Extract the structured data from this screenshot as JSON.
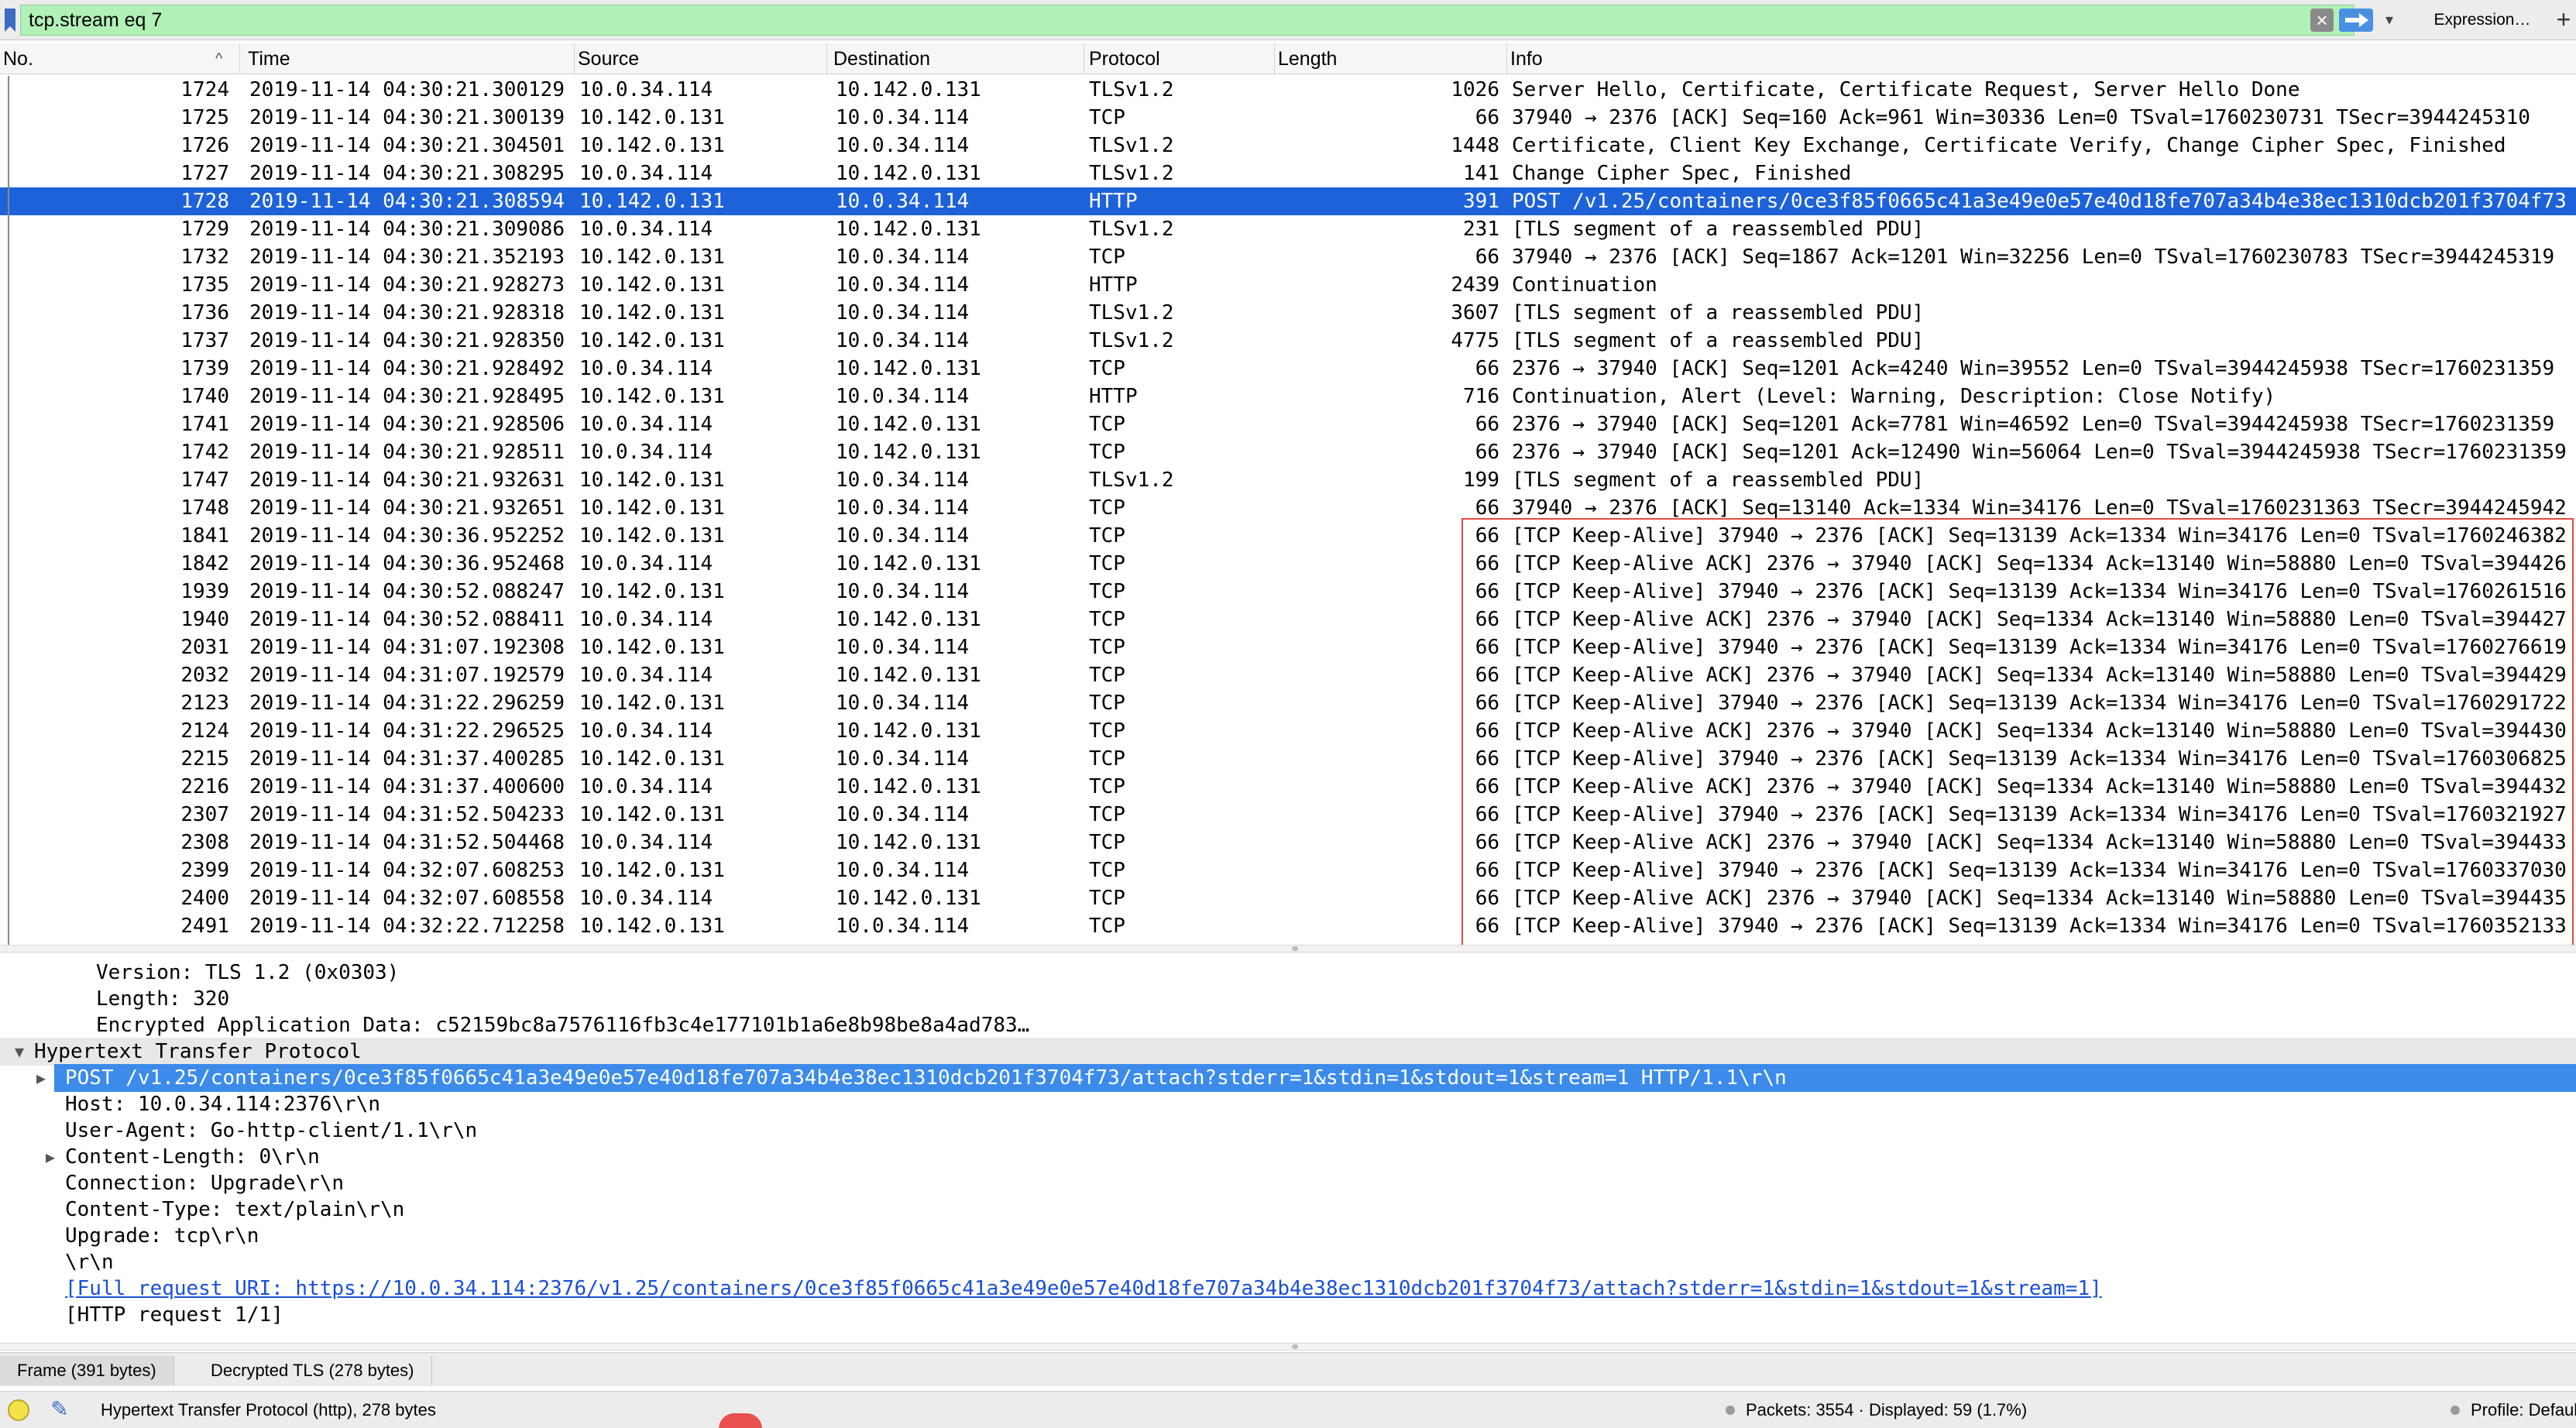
{
  "filter": {
    "expression": "tcp.stream eq 7",
    "expression_button": "Expression…",
    "add_button": "+"
  },
  "columns": [
    "No.",
    "Time",
    "Source",
    "Destination",
    "Protocol",
    "Length",
    "Info"
  ],
  "packets": [
    {
      "no": "1724",
      "time": "2019-11-14 04:30:21.300129",
      "src": "10.0.34.114",
      "dst": "10.142.0.131",
      "proto": "TLSv1.2",
      "len": "1026",
      "info": "Server Hello, Certificate, Certificate Request, Server Hello Done"
    },
    {
      "no": "1725",
      "time": "2019-11-14 04:30:21.300139",
      "src": "10.142.0.131",
      "dst": "10.0.34.114",
      "proto": "TCP",
      "len": "66",
      "info": "37940 → 2376 [ACK] Seq=160 Ack=961 Win=30336 Len=0 TSval=1760230731 TSecr=3944245310"
    },
    {
      "no": "1726",
      "time": "2019-11-14 04:30:21.304501",
      "src": "10.142.0.131",
      "dst": "10.0.34.114",
      "proto": "TLSv1.2",
      "len": "1448",
      "info": "Certificate, Client Key Exchange, Certificate Verify, Change Cipher Spec, Finished"
    },
    {
      "no": "1727",
      "time": "2019-11-14 04:30:21.308295",
      "src": "10.0.34.114",
      "dst": "10.142.0.131",
      "proto": "TLSv1.2",
      "len": "141",
      "info": "Change Cipher Spec, Finished"
    },
    {
      "no": "1728",
      "time": "2019-11-14 04:30:21.308594",
      "src": "10.142.0.131",
      "dst": "10.0.34.114",
      "proto": "HTTP",
      "len": "391",
      "info": "POST /v1.25/containers/0ce3f85f0665c41a3e49e0e57e40d18fe707a34b4e38ec1310dcb201f3704f73",
      "selected": true
    },
    {
      "no": "1729",
      "time": "2019-11-14 04:30:21.309086",
      "src": "10.0.34.114",
      "dst": "10.142.0.131",
      "proto": "TLSv1.2",
      "len": "231",
      "info": "[TLS segment of a reassembled PDU]"
    },
    {
      "no": "1732",
      "time": "2019-11-14 04:30:21.352193",
      "src": "10.142.0.131",
      "dst": "10.0.34.114",
      "proto": "TCP",
      "len": "66",
      "info": "37940 → 2376 [ACK] Seq=1867 Ack=1201 Win=32256 Len=0 TSval=1760230783 TSecr=3944245319"
    },
    {
      "no": "1735",
      "time": "2019-11-14 04:30:21.928273",
      "src": "10.142.0.131",
      "dst": "10.0.34.114",
      "proto": "HTTP",
      "len": "2439",
      "info": "Continuation"
    },
    {
      "no": "1736",
      "time": "2019-11-14 04:30:21.928318",
      "src": "10.142.0.131",
      "dst": "10.0.34.114",
      "proto": "TLSv1.2",
      "len": "3607",
      "info": "[TLS segment of a reassembled PDU]"
    },
    {
      "no": "1737",
      "time": "2019-11-14 04:30:21.928350",
      "src": "10.142.0.131",
      "dst": "10.0.34.114",
      "proto": "TLSv1.2",
      "len": "4775",
      "info": "[TLS segment of a reassembled PDU]"
    },
    {
      "no": "1739",
      "time": "2019-11-14 04:30:21.928492",
      "src": "10.0.34.114",
      "dst": "10.142.0.131",
      "proto": "TCP",
      "len": "66",
      "info": "2376 → 37940 [ACK] Seq=1201 Ack=4240 Win=39552 Len=0 TSval=3944245938 TSecr=1760231359"
    },
    {
      "no": "1740",
      "time": "2019-11-14 04:30:21.928495",
      "src": "10.142.0.131",
      "dst": "10.0.34.114",
      "proto": "HTTP",
      "len": "716",
      "info": "Continuation, Alert (Level: Warning, Description: Close Notify)"
    },
    {
      "no": "1741",
      "time": "2019-11-14 04:30:21.928506",
      "src": "10.0.34.114",
      "dst": "10.142.0.131",
      "proto": "TCP",
      "len": "66",
      "info": "2376 → 37940 [ACK] Seq=1201 Ack=7781 Win=46592 Len=0 TSval=3944245938 TSecr=1760231359"
    },
    {
      "no": "1742",
      "time": "2019-11-14 04:30:21.928511",
      "src": "10.0.34.114",
      "dst": "10.142.0.131",
      "proto": "TCP",
      "len": "66",
      "info": "2376 → 37940 [ACK] Seq=1201 Ack=12490 Win=56064 Len=0 TSval=3944245938 TSecr=1760231359"
    },
    {
      "no": "1747",
      "time": "2019-11-14 04:30:21.932631",
      "src": "10.142.0.131",
      "dst": "10.0.34.114",
      "proto": "TLSv1.2",
      "len": "199",
      "info": "[TLS segment of a reassembled PDU]"
    },
    {
      "no": "1748",
      "time": "2019-11-14 04:30:21.932651",
      "src": "10.142.0.131",
      "dst": "10.0.34.114",
      "proto": "TCP",
      "len": "66",
      "info": "37940 → 2376 [ACK] Seq=13140 Ack=1334 Win=34176 Len=0 TSval=1760231363 TSecr=3944245942"
    },
    {
      "no": "1841",
      "time": "2019-11-14 04:30:36.952252",
      "src": "10.142.0.131",
      "dst": "10.0.34.114",
      "proto": "TCP",
      "len": "66",
      "info": "[TCP Keep-Alive] 37940 → 2376 [ACK] Seq=13139 Ack=1334 Win=34176 Len=0 TSval=1760246382"
    },
    {
      "no": "1842",
      "time": "2019-11-14 04:30:36.952468",
      "src": "10.0.34.114",
      "dst": "10.142.0.131",
      "proto": "TCP",
      "len": "66",
      "info": "[TCP Keep-Alive ACK] 2376 → 37940 [ACK] Seq=1334 Ack=13140 Win=58880 Len=0 TSval=394426"
    },
    {
      "no": "1939",
      "time": "2019-11-14 04:30:52.088247",
      "src": "10.142.0.131",
      "dst": "10.0.34.114",
      "proto": "TCP",
      "len": "66",
      "info": "[TCP Keep-Alive] 37940 → 2376 [ACK] Seq=13139 Ack=1334 Win=34176 Len=0 TSval=1760261516"
    },
    {
      "no": "1940",
      "time": "2019-11-14 04:30:52.088411",
      "src": "10.0.34.114",
      "dst": "10.142.0.131",
      "proto": "TCP",
      "len": "66",
      "info": "[TCP Keep-Alive ACK] 2376 → 37940 [ACK] Seq=1334 Ack=13140 Win=58880 Len=0 TSval=394427"
    },
    {
      "no": "2031",
      "time": "2019-11-14 04:31:07.192308",
      "src": "10.142.0.131",
      "dst": "10.0.34.114",
      "proto": "TCP",
      "len": "66",
      "info": "[TCP Keep-Alive] 37940 → 2376 [ACK] Seq=13139 Ack=1334 Win=34176 Len=0 TSval=1760276619"
    },
    {
      "no": "2032",
      "time": "2019-11-14 04:31:07.192579",
      "src": "10.0.34.114",
      "dst": "10.142.0.131",
      "proto": "TCP",
      "len": "66",
      "info": "[TCP Keep-Alive ACK] 2376 → 37940 [ACK] Seq=1334 Ack=13140 Win=58880 Len=0 TSval=394429"
    },
    {
      "no": "2123",
      "time": "2019-11-14 04:31:22.296259",
      "src": "10.142.0.131",
      "dst": "10.0.34.114",
      "proto": "TCP",
      "len": "66",
      "info": "[TCP Keep-Alive] 37940 → 2376 [ACK] Seq=13139 Ack=1334 Win=34176 Len=0 TSval=1760291722"
    },
    {
      "no": "2124",
      "time": "2019-11-14 04:31:22.296525",
      "src": "10.0.34.114",
      "dst": "10.142.0.131",
      "proto": "TCP",
      "len": "66",
      "info": "[TCP Keep-Alive ACK] 2376 → 37940 [ACK] Seq=1334 Ack=13140 Win=58880 Len=0 TSval=394430"
    },
    {
      "no": "2215",
      "time": "2019-11-14 04:31:37.400285",
      "src": "10.142.0.131",
      "dst": "10.0.34.114",
      "proto": "TCP",
      "len": "66",
      "info": "[TCP Keep-Alive] 37940 → 2376 [ACK] Seq=13139 Ack=1334 Win=34176 Len=0 TSval=1760306825"
    },
    {
      "no": "2216",
      "time": "2019-11-14 04:31:37.400600",
      "src": "10.0.34.114",
      "dst": "10.142.0.131",
      "proto": "TCP",
      "len": "66",
      "info": "[TCP Keep-Alive ACK] 2376 → 37940 [ACK] Seq=1334 Ack=13140 Win=58880 Len=0 TSval=394432"
    },
    {
      "no": "2307",
      "time": "2019-11-14 04:31:52.504233",
      "src": "10.142.0.131",
      "dst": "10.0.34.114",
      "proto": "TCP",
      "len": "66",
      "info": "[TCP Keep-Alive] 37940 → 2376 [ACK] Seq=13139 Ack=1334 Win=34176 Len=0 TSval=1760321927"
    },
    {
      "no": "2308",
      "time": "2019-11-14 04:31:52.504468",
      "src": "10.0.34.114",
      "dst": "10.142.0.131",
      "proto": "TCP",
      "len": "66",
      "info": "[TCP Keep-Alive ACK] 2376 → 37940 [ACK] Seq=1334 Ack=13140 Win=58880 Len=0 TSval=394433"
    },
    {
      "no": "2399",
      "time": "2019-11-14 04:32:07.608253",
      "src": "10.142.0.131",
      "dst": "10.0.34.114",
      "proto": "TCP",
      "len": "66",
      "info": "[TCP Keep-Alive] 37940 → 2376 [ACK] Seq=13139 Ack=1334 Win=34176 Len=0 TSval=1760337030"
    },
    {
      "no": "2400",
      "time": "2019-11-14 04:32:07.608558",
      "src": "10.0.34.114",
      "dst": "10.142.0.131",
      "proto": "TCP",
      "len": "66",
      "info": "[TCP Keep-Alive ACK] 2376 → 37940 [ACK] Seq=1334 Ack=13140 Win=58880 Len=0 TSval=394435"
    },
    {
      "no": "2491",
      "time": "2019-11-14 04:32:22.712258",
      "src": "10.142.0.131",
      "dst": "10.0.34.114",
      "proto": "TCP",
      "len": "66",
      "info": "[TCP Keep-Alive] 37940 → 2376 [ACK] Seq=13139 Ack=1334 Win=34176 Len=0 TSval=1760352133"
    }
  ],
  "details": [
    {
      "text": "Version: TLS 1.2 (0x0303)",
      "indent": 2,
      "expander": false
    },
    {
      "text": "Length: 320",
      "indent": 2,
      "expander": false
    },
    {
      "text": "Encrypted Application Data: c52159bc8a7576116fb3c4e177101b1a6e8b98be8a4ad783…",
      "indent": 2,
      "expander": false
    },
    {
      "text": "Hypertext Transfer Protocol",
      "indent": 0,
      "expander": "open",
      "section": true
    },
    {
      "text": "POST /v1.25/containers/0ce3f85f0665c41a3e49e0e57e40d18fe707a34b4e38ec1310dcb201f3704f73/attach?stderr=1&stdin=1&stdout=1&stream=1 HTTP/1.1\\r\\n",
      "indent": 1,
      "expander": "closed",
      "selected": true
    },
    {
      "text": "Host: 10.0.34.114:2376\\r\\n",
      "indent": 1,
      "expander": false
    },
    {
      "text": "User-Agent: Go-http-client/1.1\\r\\n",
      "indent": 1,
      "expander": false
    },
    {
      "text": "Content-Length: 0\\r\\n",
      "indent": 1,
      "expander": "closed"
    },
    {
      "text": "Connection: Upgrade\\r\\n",
      "indent": 1,
      "expander": false
    },
    {
      "text": "Content-Type: text/plain\\r\\n",
      "indent": 1,
      "expander": false
    },
    {
      "text": "Upgrade: tcp\\r\\n",
      "indent": 1,
      "expander": false
    },
    {
      "text": "\\r\\n",
      "indent": 1,
      "expander": false
    },
    {
      "text": "[Full request URI: https://10.0.34.114:2376/v1.25/containers/0ce3f85f0665c41a3e49e0e57e40d18fe707a34b4e38ec1310dcb201f3704f73/attach?stderr=1&stdin=1&stdout=1&stream=1]",
      "indent": 1,
      "expander": false,
      "link": true
    },
    {
      "text": "[HTTP request 1/1]",
      "indent": 1,
      "expander": false
    }
  ],
  "bytes_tabs": [
    "Frame (391 bytes)",
    "Decrypted TLS (278 bytes)"
  ],
  "status": {
    "field": "Hypertext Transfer Protocol (http), 278 bytes",
    "packets": "Packets: 3554 · Displayed: 59 (1.7%)",
    "profile": "Profile: Default"
  },
  "colors": {
    "filter_valid": "#b2f1b6",
    "selected_row": "#1d62d9",
    "selected_detail": "#3c8bea",
    "highlight_box": "#e04c3f",
    "link": "#1a4fd6"
  },
  "icons": [
    "bookmark-icon",
    "clear-filter-icon",
    "apply-filter-icon",
    "dropdown-icon",
    "sort-ascending-icon",
    "expand-arrow-icon",
    "collapse-arrow-icon",
    "expert-info-icon",
    "capture-comment-icon"
  ]
}
